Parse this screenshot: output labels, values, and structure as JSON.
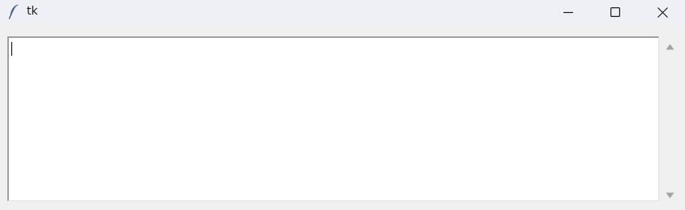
{
  "window": {
    "title": "tk",
    "app_icon": "feather-icon",
    "controls": {
      "minimize_icon": "minimize-icon",
      "maximize_icon": "maximize-icon",
      "close_icon": "close-icon"
    }
  },
  "editor": {
    "value": ""
  },
  "scrollbar": {
    "up_icon": "scroll-up-arrow-icon",
    "down_icon": "scroll-down-arrow-icon"
  },
  "colors": {
    "titlebar_bg": "#eef0f6",
    "window_bg": "#f0f0f0",
    "text_bg": "#ffffff",
    "scroll_arrow": "#a3a3a3"
  }
}
